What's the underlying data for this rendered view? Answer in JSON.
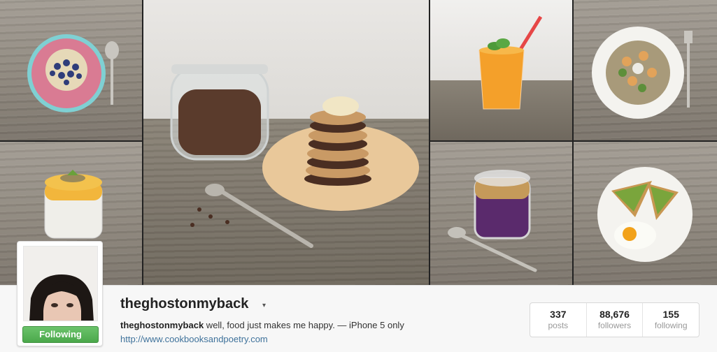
{
  "profile": {
    "username": "theghostonmyback",
    "bio_name": "theghostonmyback",
    "bio_text": " well, food just makes me happy. — iPhone 5 only",
    "website": "http://www.cookbooksandpoetry.com",
    "follow_button": "Following",
    "caret": "▾"
  },
  "stats": [
    {
      "value": "337",
      "label": "posts"
    },
    {
      "value": "88,676",
      "label": "followers"
    },
    {
      "value": "155",
      "label": "following"
    }
  ],
  "colors": {
    "follow_green": "#4ba84b",
    "link_blue": "#3f729b"
  }
}
